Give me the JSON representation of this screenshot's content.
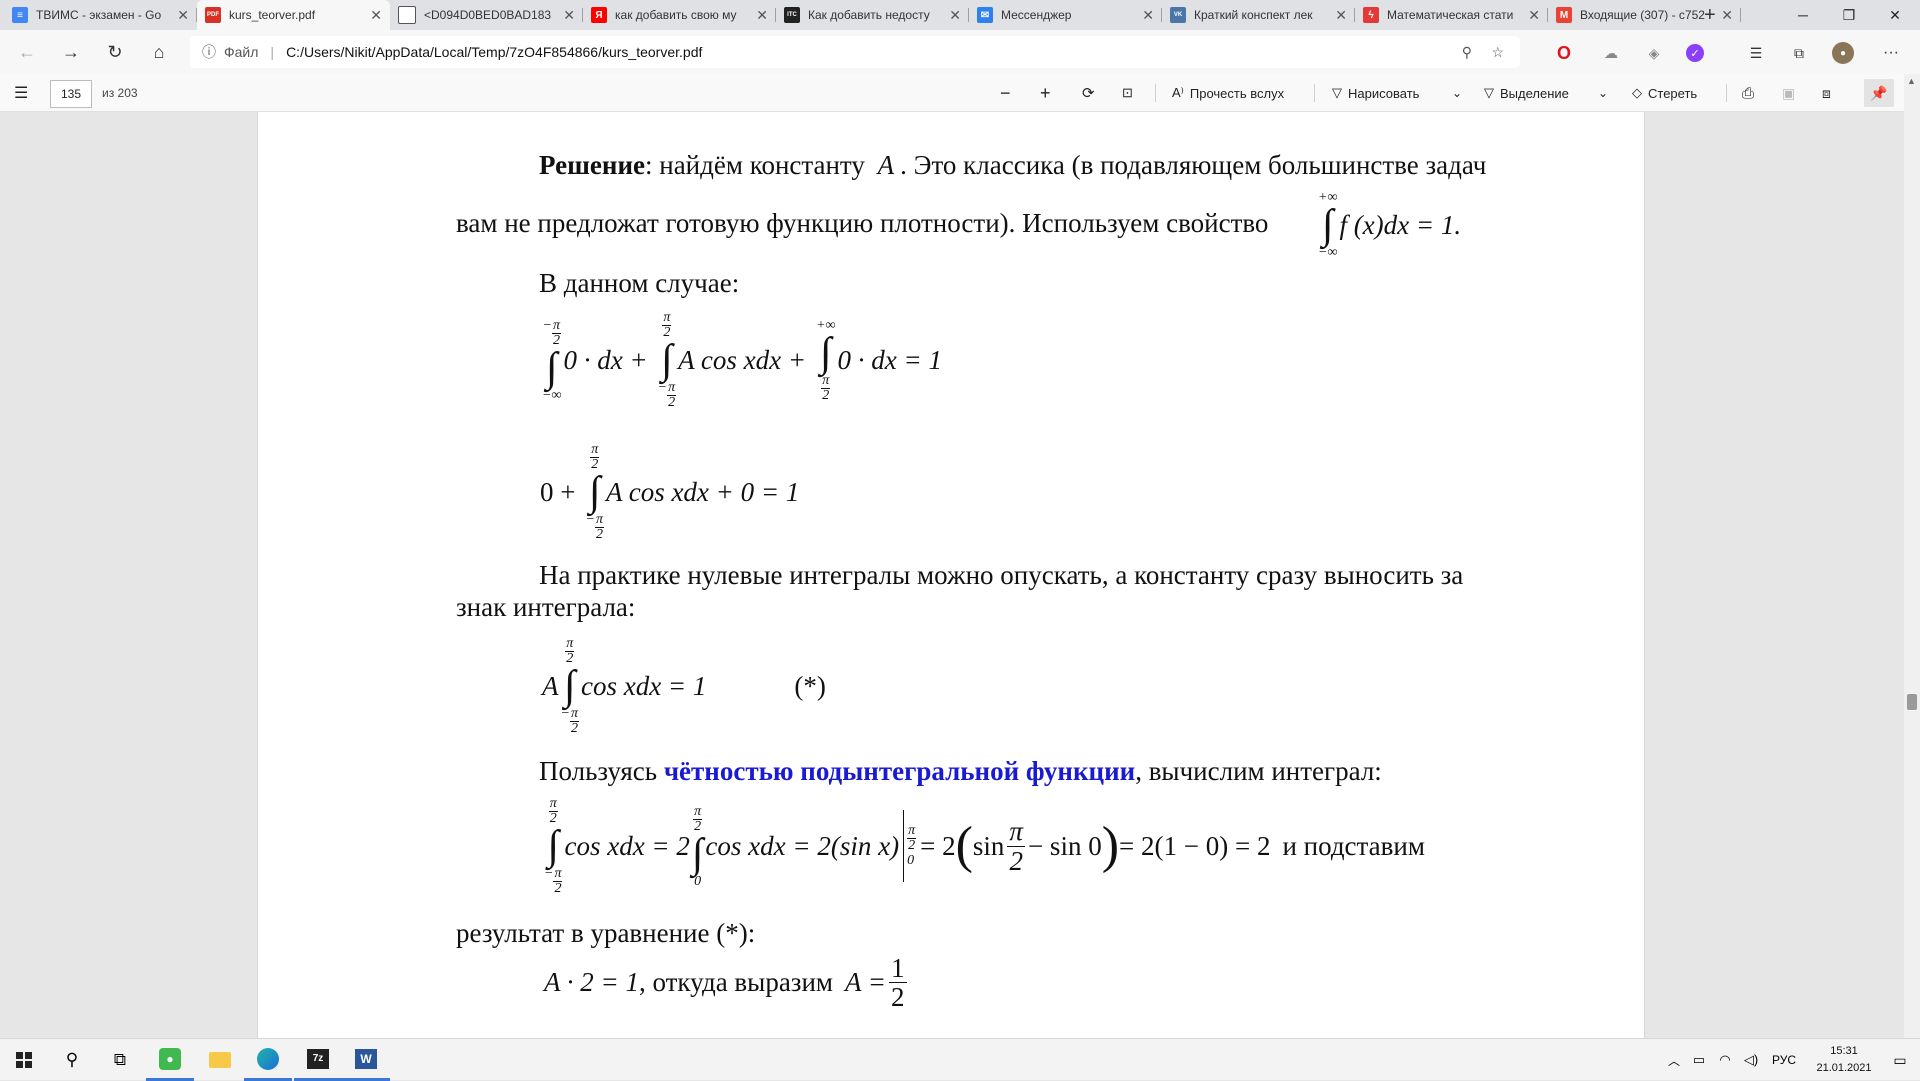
{
  "tabs": [
    {
      "title": "ТВИМС - экзамен - Go",
      "icon": "docs-icon",
      "color": "#4285f4",
      "glyph": "≡"
    },
    {
      "title": "kurs_teorver.pdf",
      "icon": "pdf-icon",
      "color": "#d93025",
      "glyph": "PDF",
      "active": true
    },
    {
      "title": "<D094D0BED0BAD183",
      "icon": "page-icon",
      "color": "#ffffff",
      "glyph": ""
    },
    {
      "title": "как добавить свою му",
      "icon": "yandex-icon",
      "color": "#ff0000",
      "glyph": "Я"
    },
    {
      "title": "Как добавить недосту",
      "icon": "site-icon",
      "color": "#222222",
      "glyph": "ITC"
    },
    {
      "title": "Мессенджер",
      "icon": "messenger-icon",
      "color": "#2f80ed",
      "glyph": "✉"
    },
    {
      "title": "Краткий конспект лек",
      "icon": "vk-icon",
      "color": "#4a76a8",
      "glyph": "VK"
    },
    {
      "title": "Математическая стати",
      "icon": "lightning-icon",
      "color": "#e53935",
      "glyph": "ϟ"
    },
    {
      "title": "Входящие (307) - c752",
      "icon": "gmail-icon",
      "color": "#ea4335",
      "glyph": "M"
    }
  ],
  "address": {
    "scheme_label": "Файл",
    "url": "C:/Users/Nikit/AppData/Local/Temp/7zO4F854866/kurs_teorver.pdf"
  },
  "toolbar": {
    "page_number": "135",
    "page_total": "из 203",
    "read_aloud": "Прочесть вслух",
    "draw": "Нарисовать",
    "highlight": "Выделение",
    "erase": "Стереть"
  },
  "document": {
    "p1_bold": "Решение",
    "p1_text": ": найдём константу",
    "p1_var": "A",
    "p1_rest": ". Это классика (в подавляющем большинстве задач",
    "p2_text": "вам не предложат готовую функцию плотности). Используем свойство",
    "p2_formula_upper": "+∞",
    "p2_formula_lower": "−∞",
    "p2_formula_body": "f (x)dx = 1.",
    "p3_text": "В данном случае:",
    "eq1_part1": "0 · dx +",
    "eq1_part2": "A cos xdx +",
    "eq1_part3": "0 · dx = 1",
    "eq1_lims": {
      "l1_up": "−π/2",
      "l1_low": "−∞",
      "l2_up": "π/2",
      "l2_low": "−π/2",
      "l3_up": "+∞",
      "l3_low": "π/2"
    },
    "eq2_prefix": "0 +",
    "eq2_body": "A cos xdx + 0 = 1",
    "p4_text": "На практике нулевые интегралы можно опускать, а константу сразу выносить за",
    "p5_text": "знак интеграла:",
    "eq3_prefix": "A",
    "eq3_body": "cos xdx = 1",
    "eq3_tag": "(*)",
    "p6_before": "Пользуясь ",
    "p6_link": "чётностью подынтегральной функции",
    "p6_after": ", вычислим интеграл:",
    "eq4_a": "cos xdx = 2",
    "eq4_b": "cos xdx = 2(sin x)",
    "eq4_c": "= 2",
    "eq4_sin": "sin",
    "eq4_d": "− sin 0",
    "eq4_e": "= 2(1 − 0) = 2",
    "eq4_after": "и подставим",
    "p7_text": "результат в уравнение (*):",
    "eq5_left": "A · 2 = 1",
    "eq5_mid": ", откуда выразим",
    "eq5_var": "A =",
    "eq5_num": "1",
    "eq5_den": "2",
    "pi": "π",
    "two": "2",
    "zero": "0",
    "neg": "−"
  },
  "taskbar": {
    "language": "РУС",
    "time": "15:31",
    "date": "21.01.2021"
  }
}
